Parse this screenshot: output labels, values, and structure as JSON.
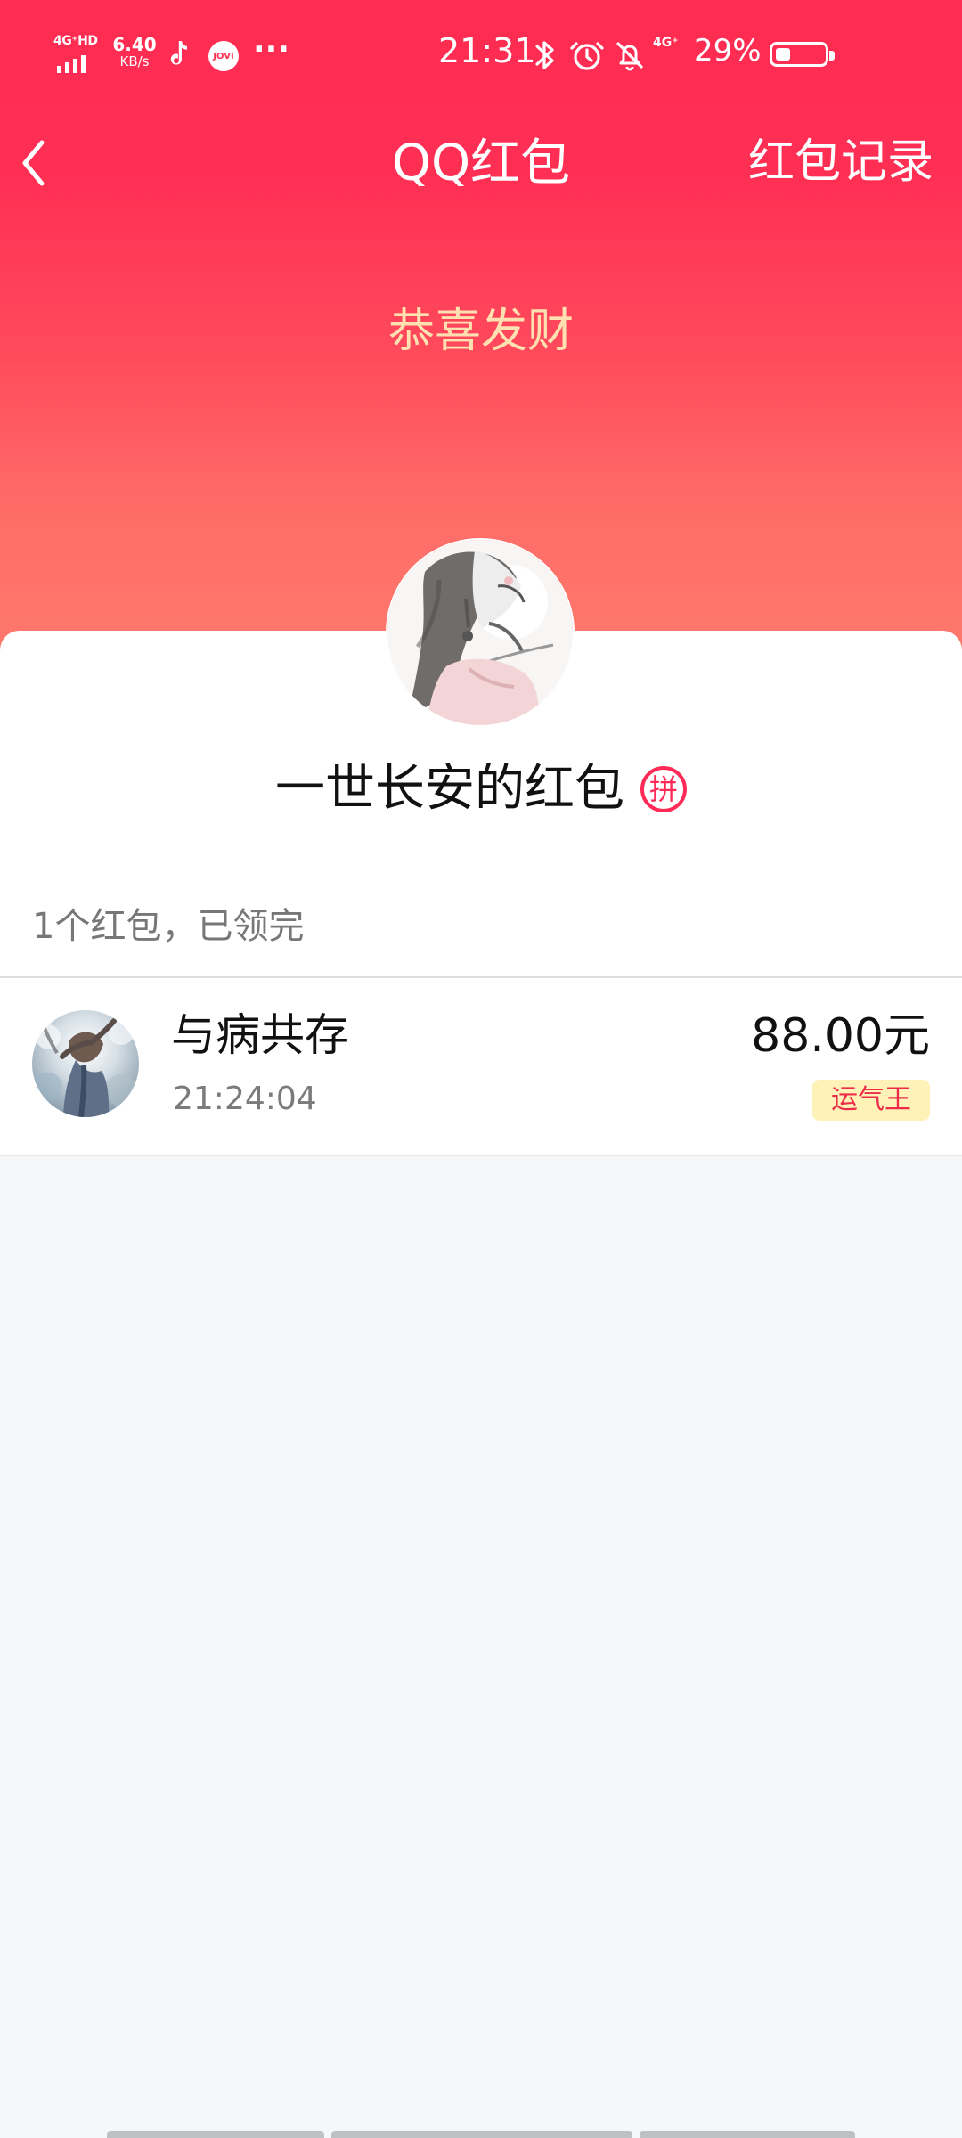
{
  "status_bar": {
    "network": "4G⁺HD",
    "speed_value": "6.40",
    "speed_unit": "KB/s",
    "more": "···",
    "time": "21:31",
    "secondary_network": "4G⁺",
    "battery_percent": "29%",
    "battery_level": 0.29,
    "jovi_label": "JOVI"
  },
  "header": {
    "title": "QQ红包",
    "right_label": "红包记录",
    "blessing": "恭喜发财"
  },
  "sender": {
    "name": "一世长安的红包",
    "pin_label": "拼"
  },
  "summary": {
    "text": "1个红包，已领完"
  },
  "recipient": {
    "name": "与病共存",
    "time": "21:24:04",
    "amount": "88.00元",
    "badge": "运气王"
  },
  "colors": {
    "accent": "#ff2b52",
    "gold_text": "#ffe0b1",
    "badge_bg": "#fff2b8",
    "badge_text": "#ec2c48"
  },
  "icons": {
    "back": "chevron-left-icon",
    "bluetooth": "bluetooth-icon",
    "alarm": "alarm-icon",
    "notifications_off": "bell-off-icon",
    "battery": "battery-icon",
    "tiktok": "tiktok-icon"
  }
}
